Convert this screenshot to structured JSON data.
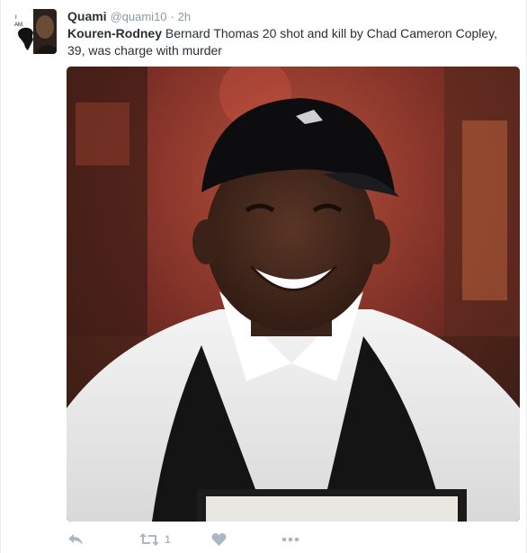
{
  "tweet": {
    "fullname": "Quami",
    "username": "@quami10",
    "separator": "·",
    "time": "2h",
    "mention": "Kouren-Rodney",
    "text": " Bernard Thomas 20  shot and kill by Chad Cameron Copley, 39, was charge with murder"
  },
  "avatar": {
    "caption_line1": "I",
    "caption_line2": "AM"
  },
  "actions": {
    "reply_icon": "reply-icon",
    "retweet_icon": "retweet-icon",
    "retweet_count": "1",
    "like_icon": "heart-icon",
    "more_icon": "more-icon"
  },
  "colors": {
    "text": "#292f33",
    "muted": "#8899a6",
    "action": "#aab8c2"
  }
}
